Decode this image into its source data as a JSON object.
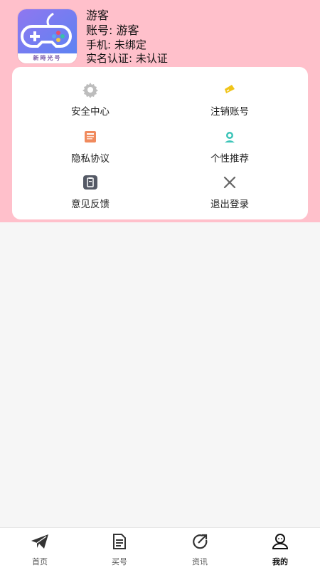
{
  "profile": {
    "name": "游客",
    "account": "账号: 游客",
    "phone": "手机: 未绑定",
    "realname": "实名认证: 未认证",
    "logo_text": "新時光号"
  },
  "menu": {
    "security": "安全中心",
    "cancel_account": "注销账号",
    "privacy": "隐私协议",
    "recommend": "个性推荐",
    "feedback": "意见反馈",
    "logout": "退出登录"
  },
  "tabbar": {
    "home": "首页",
    "buy": "买号",
    "news": "资讯",
    "mine": "我的",
    "active": "mine"
  },
  "colors": {
    "header_bg": "#ffc0cb",
    "page_bg": "#f6f6f6",
    "accent_yellow": "#f0c419",
    "accent_teal": "#3cc4b8",
    "accent_orange": "#f08a5d"
  }
}
